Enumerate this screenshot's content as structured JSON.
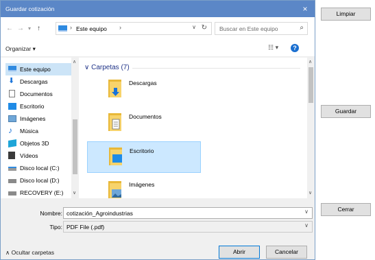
{
  "dialog": {
    "title": "Guardar cotización",
    "close_label": "×",
    "address": {
      "location": "Este equipo",
      "separator": "›"
    },
    "search_placeholder": "Buscar en Este equipo",
    "toolbar": {
      "organize_label": "Organizar ▾"
    },
    "nav_items": [
      {
        "label": "Este equipo",
        "icon": "computer-icon",
        "selected": true
      },
      {
        "label": "Descargas",
        "icon": "download-icon"
      },
      {
        "label": "Documentos",
        "icon": "document-icon"
      },
      {
        "label": "Escritorio",
        "icon": "desktop-icon"
      },
      {
        "label": "Imágenes",
        "icon": "pictures-icon"
      },
      {
        "label": "Música",
        "icon": "music-icon"
      },
      {
        "label": "Objetos 3D",
        "icon": "3d-objects-icon"
      },
      {
        "label": "Vídeos",
        "icon": "videos-icon"
      },
      {
        "label": "Disco local (C:)",
        "icon": "drive-icon"
      },
      {
        "label": "Disco local (D:)",
        "icon": "drive-icon"
      },
      {
        "label": "RECOVERY (E:)",
        "icon": "drive-icon"
      }
    ],
    "group_header": "Carpetas (7)",
    "folders": [
      {
        "label": "Descargas"
      },
      {
        "label": "Documentos"
      },
      {
        "label": "Escritorio",
        "selected": true
      },
      {
        "label": "Imágenes"
      }
    ],
    "filename_label": "Nombre:",
    "filename_value": "cotización_Agroindustrias",
    "filetype_label": "Tipo:",
    "filetype_value": "PDF File (.pdf)",
    "hide_folders_label": "Ocultar carpetas",
    "open_label": "Abrir",
    "cancel_label": "Cancelar"
  },
  "side_buttons": {
    "clear_label": "Limpiar",
    "save_label": "Guardar",
    "close_label": "Cerrar"
  },
  "colors": {
    "titlebar": "#5b87c7",
    "selection": "#cce8ff",
    "accent": "#0078d7"
  }
}
